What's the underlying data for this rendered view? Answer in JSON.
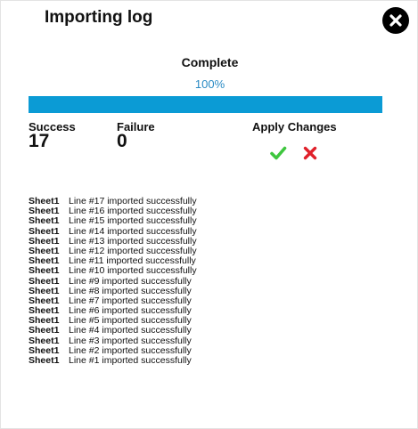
{
  "dialog": {
    "title": "Importing log",
    "close_icon": "close-icon"
  },
  "progress": {
    "status": "Complete",
    "percent_label": "100%",
    "value": 1.0,
    "fill_color": "#0b9bd5"
  },
  "stats": {
    "success_label": "Success",
    "success_value": "17",
    "failure_label": "Failure",
    "failure_value": "0"
  },
  "apply": {
    "label": "Apply Changes",
    "confirm_icon": "checkmark-icon",
    "confirm_color": "#3ec63e",
    "cancel_icon": "cross-icon",
    "cancel_color": "#e0202a"
  },
  "log": [
    {
      "sheet": "Sheet1",
      "message": "Line #17 imported successfully"
    },
    {
      "sheet": "Sheet1",
      "message": "Line #16 imported successfully"
    },
    {
      "sheet": "Sheet1",
      "message": "Line #15 imported successfully"
    },
    {
      "sheet": "Sheet1",
      "message": "Line #14 imported successfully"
    },
    {
      "sheet": "Sheet1",
      "message": "Line #13 imported successfully"
    },
    {
      "sheet": "Sheet1",
      "message": "Line #12 imported successfully"
    },
    {
      "sheet": "Sheet1",
      "message": "Line #11 imported successfully"
    },
    {
      "sheet": "Sheet1",
      "message": "Line #10 imported successfully"
    },
    {
      "sheet": "Sheet1",
      "message": "Line #9 imported successfully"
    },
    {
      "sheet": "Sheet1",
      "message": "Line #8 imported successfully"
    },
    {
      "sheet": "Sheet1",
      "message": "Line #7 imported successfully"
    },
    {
      "sheet": "Sheet1",
      "message": "Line #6 imported successfully"
    },
    {
      "sheet": "Sheet1",
      "message": "Line #5 imported successfully"
    },
    {
      "sheet": "Sheet1",
      "message": "Line #4 imported successfully"
    },
    {
      "sheet": "Sheet1",
      "message": "Line #3 imported successfully"
    },
    {
      "sheet": "Sheet1",
      "message": "Line #2 imported successfully"
    },
    {
      "sheet": "Sheet1",
      "message": "Line #1 imported successfully"
    }
  ]
}
